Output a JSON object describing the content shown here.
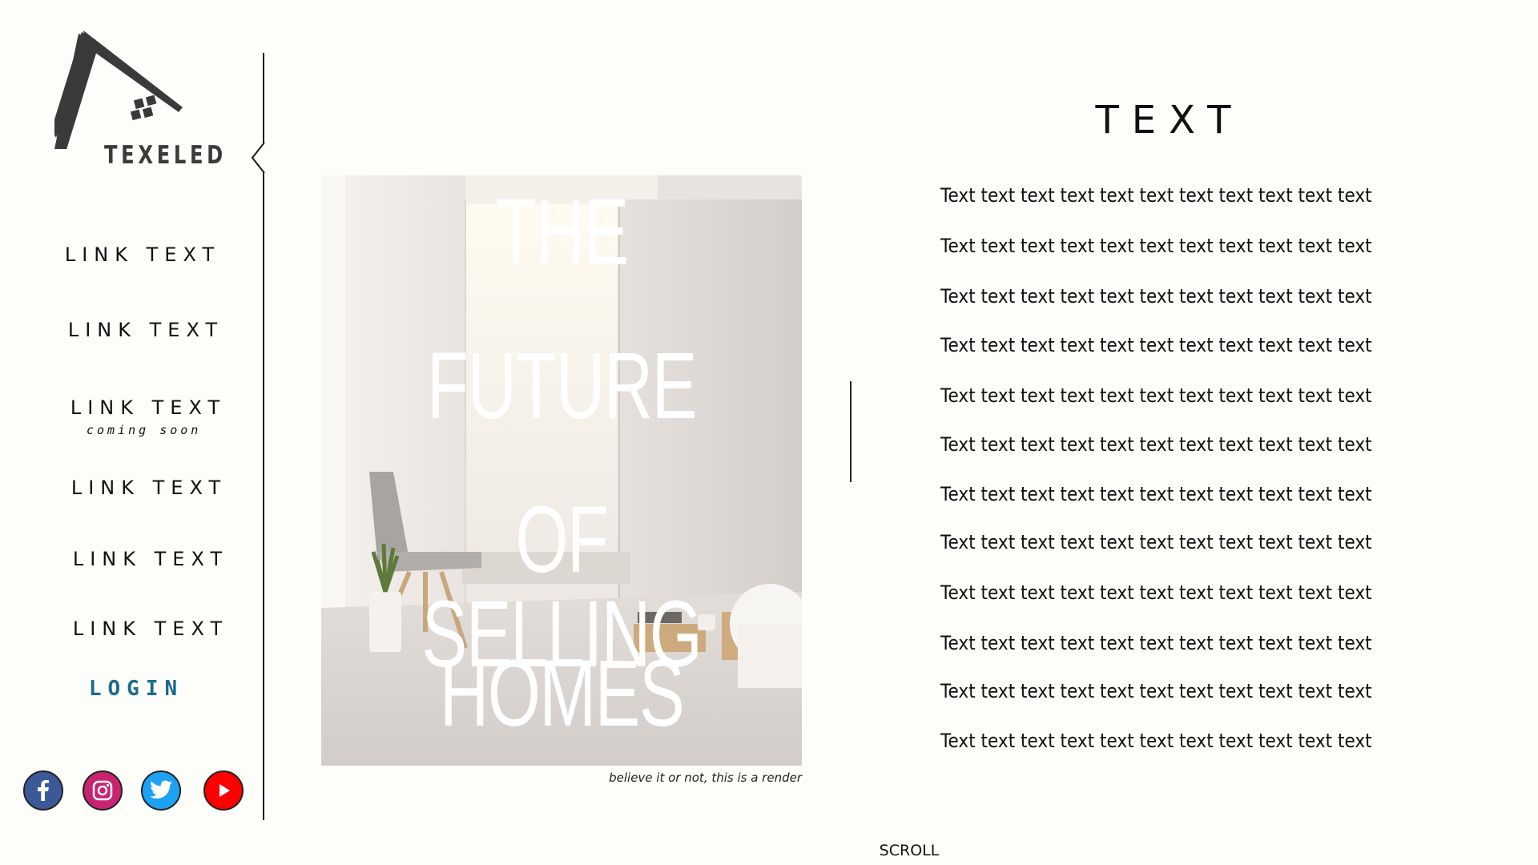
{
  "brand": {
    "name": "TEXELED"
  },
  "nav": {
    "links": [
      "LINK TEXT",
      "LINK TEXT",
      "LINK TEXT",
      "LINK TEXT",
      "LINK TEXT",
      "LINK TEXT"
    ],
    "coming_soon": "coming soon",
    "login": "LOGIN"
  },
  "social": [
    "facebook",
    "instagram",
    "twitter",
    "youtube"
  ],
  "hero": {
    "lines": [
      "THE",
      "FUTURE",
      "OF SELLING",
      "HOMES"
    ],
    "caption": "believe it or not, this is a render"
  },
  "section": {
    "title": "TEXT",
    "lines": [
      "Text text text text text text text text text text text",
      "Text text text text text text text text text text text",
      "Text text text text text text text text text text text",
      "Text text text text text text text text text text text",
      "Text text text text text text text text text text text",
      "Text text text text text text text text text text text",
      "Text text text text text text text text text text text",
      "Text text text text text text text text text text text",
      "Text text text text text text text text text text text",
      "Text text text text text text text text text text text",
      "Text text text text text text text text text text text",
      "Text text text text text text text text text text text"
    ]
  },
  "scroll": "SCROLL",
  "colors": {
    "background": "#fdfdf9",
    "login": "#1b6a91",
    "facebook": "#3b5998",
    "instagram": "#c8246f",
    "twitter": "#1da1f2",
    "youtube": "#ff0000"
  }
}
